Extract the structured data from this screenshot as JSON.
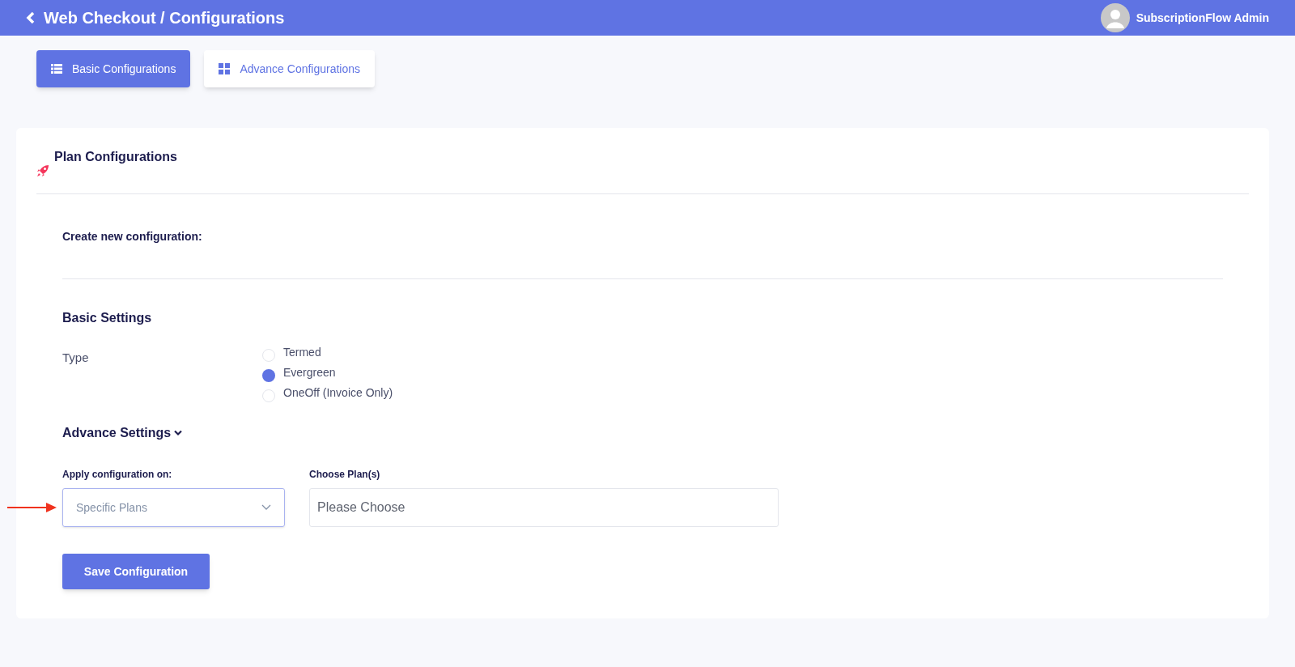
{
  "header": {
    "title": "Web Checkout / Configurations",
    "user": "SubscriptionFlow Admin"
  },
  "tabs": [
    {
      "label": "Basic Configurations",
      "selected": true,
      "kind": "list"
    },
    {
      "label": "Advance Configurations",
      "selected": false,
      "kind": "grid"
    }
  ],
  "card": {
    "title": "Plan Configurations",
    "subtitle": "Create new configuration:",
    "basic_settings": {
      "heading": "Basic Settings",
      "label": "Type",
      "options": [
        {
          "label": "Termed",
          "selected": false
        },
        {
          "label": "Evergreen",
          "selected": true
        },
        {
          "label": "OneOff (Invoice Only)",
          "selected": false
        }
      ]
    },
    "advance_settings": {
      "heading": "Advance Settings",
      "expanded": true,
      "apply_label": "Apply configuration on:",
      "apply_value": "Specific Plans",
      "plans_label": "Choose Plan(s)",
      "plans_placeholder": "Please Choose"
    },
    "save_button": "Save Configuration"
  }
}
